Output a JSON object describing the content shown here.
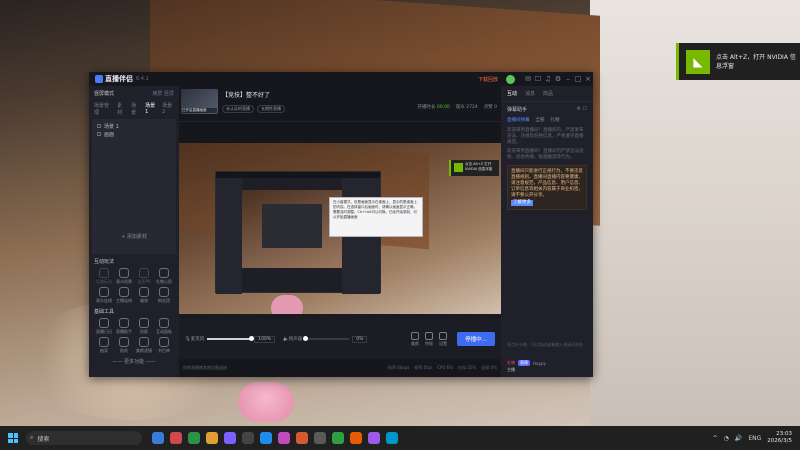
{
  "nvidia_toast": {
    "text": "点击 Alt+Z，打开 NVIDIA 信息浮窗"
  },
  "app": {
    "name": "直播伴侣",
    "version": "6.4.1",
    "titlebar": {
      "record_label": "下载回放",
      "icons": [
        "gift-icon",
        "message-icon",
        "headset-icon",
        "settings-icon",
        "minimize-icon",
        "maximize-icon",
        "close-icon"
      ]
    },
    "left": {
      "mode_label": "竖屏模式",
      "mode_right": [
        "横屏",
        "竖屏"
      ],
      "scene_tabs": [
        "场景管理",
        "素材",
        "场景",
        "场景1",
        "场景2"
      ],
      "scene_items": [
        "场景 1",
        "画面"
      ],
      "add_source": "+ 添加素材",
      "interact_title": "互动玩法",
      "interact_tools": [
        {
          "label": "礼物玩法",
          "dim": true
        },
        {
          "label": "观众投票",
          "dim": false
        },
        {
          "label": "连麦PK",
          "dim": true
        },
        {
          "label": "礼物心愿",
          "dim": false
        },
        {
          "label": "观众连线",
          "dim": false
        },
        {
          "label": "主播连线",
          "dim": false
        },
        {
          "label": "福袋",
          "dim": false
        },
        {
          "label": "粉丝团",
          "dim": false
        }
      ],
      "basic_title": "基础工具",
      "basic_tools": [
        {
          "label": "直播日记",
          "dim": false
        },
        {
          "label": "直播助手",
          "dim": false
        },
        {
          "label": "投屏",
          "dim": false
        },
        {
          "label": "互动面板",
          "dim": false
        },
        {
          "label": "抽奖",
          "dim": false
        },
        {
          "label": "贴纸",
          "dim": false
        },
        {
          "label": "美颜滤镜",
          "dim": false
        },
        {
          "label": "节目单",
          "dim": false
        }
      ],
      "more_tools": "—— 更多功能 ——"
    },
    "center": {
      "room_thumb_caption": "已开启直播画面",
      "room_title": "【竞技】整不好了",
      "room_tags": [
        "未认证的直播",
        "长期性直播"
      ],
      "stats": [
        {
          "label": "开播时长",
          "value": "00:00",
          "green": true
        },
        {
          "label": "观众",
          "value": "2724",
          "green": false
        },
        {
          "label": "点赞",
          "value": "0",
          "green": false
        }
      ],
      "hint": "",
      "preview_tooltip": "在小窗模式，但是画面显示在桌面上，显示的是桌面上的内容。在选择窗口后画面时，请确认画面显示正确，需要及时调整。Ctrl+Alt可以切换。已经开始录制，可以开始直播画面",
      "preview_nv_toast": "点击 Alt+Z 打开 NVIDIA 信息浮窗",
      "mic_label": "麦克风",
      "mic_volume": "100%",
      "mic_level": 1.0,
      "speaker_label": "扬声器",
      "speaker_volume": "0%",
      "speaker_level": 0.0,
      "actions": [
        "美颜",
        "特效",
        "设置"
      ],
      "live_button": "停播中...",
      "status_left": "你的直播被其他设备连接",
      "status_right": [
        "码率:0kbps",
        "帧率:0fps",
        "CPU:6%",
        "内存:32%",
        "丢帧:0%"
      ]
    },
    "right": {
      "tabs": [
        "互动",
        "消息",
        "商品"
      ],
      "panel_title": "弹幕助手",
      "sub_tabs": [
        "直播间弹幕",
        "全部",
        "礼物"
      ],
      "system_msg": "欢迎来到直播间！直播间内，严禁发布违法、违规及低俗信息，严格遵守直播规范。",
      "system_msg2": "欢迎来到直播间！直播间内严禁违法违规、低俗色情、吸烟酗酒等行为。",
      "notice": "直播间只能进行正规行为，不要违反直播规则。直播间直播内容要健康，请注意规范，产品信息、用户信息、订单信息等相关内容属于商业机密，请不要公开分享。",
      "notice_link": "了解更多",
      "input_placeholder": "说点什么吧，可以发送或者输入关键词消息",
      "bottom_items": [
        "礼物",
        "表情",
        "Happy"
      ],
      "user": "主播"
    }
  },
  "taskbar": {
    "search_placeholder": "搜索",
    "tray_lang": "ENG",
    "time": "23:03",
    "date": "2026/3/5",
    "app_colors": [
      "#3a7bd5",
      "#d04a4a",
      "#2b9348",
      "#e0a030",
      "#7b61ff",
      "#444444",
      "#1f8ceb",
      "#c04cc0",
      "#d65a31",
      "#5a5a5a",
      "#2ea043",
      "#e85d04",
      "#9b5de5",
      "#0096c7"
    ]
  }
}
